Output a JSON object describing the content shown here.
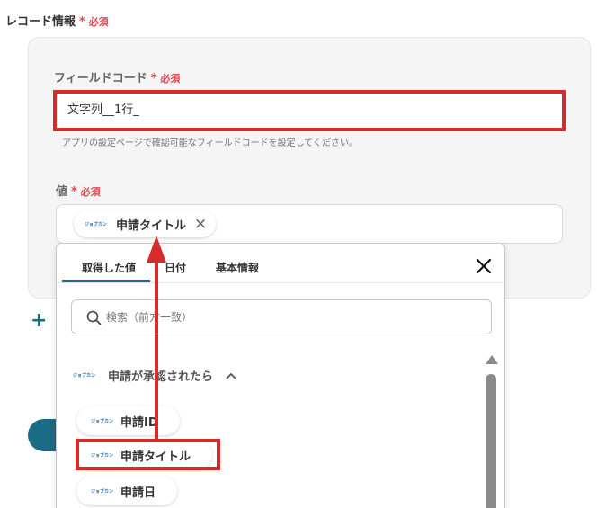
{
  "record_section": {
    "title": "レコード情報",
    "required_mark": "*",
    "required_label": "必須"
  },
  "field_code": {
    "label": "フィールドコード",
    "required_mark": "*",
    "required_label": "必須",
    "value": "文字列__1行_",
    "help": "アプリの設定ページで確認可能なフィールドコードを設定してください。"
  },
  "value_field": {
    "label": "値",
    "required_mark": "*",
    "required_label": "必須",
    "chip": {
      "logo": "ジョブカン",
      "text": "申請タイトル",
      "remove_glyph": "×"
    }
  },
  "add_button": {
    "glyph": "+"
  },
  "dropdown": {
    "tabs": [
      {
        "label": "取得した値",
        "active": true
      },
      {
        "label": "日付",
        "active": false
      },
      {
        "label": "基本情報",
        "active": false
      }
    ],
    "search": {
      "placeholder": "検索（前方一致）",
      "value": ""
    },
    "group": {
      "logo": "ジョブカン",
      "label": "申請が承認されたら",
      "expanded": true
    },
    "items": [
      {
        "logo": "ジョブカン",
        "text": "申請ID"
      },
      {
        "logo": "ジョブカン",
        "text": "申請タイトル"
      },
      {
        "logo": "ジョブカン",
        "text": "申請日"
      }
    ]
  },
  "colors": {
    "accent": "#1c6b84",
    "required": "#e5484d",
    "highlight": "#d72b2b",
    "logo": "#1e6fbf"
  }
}
